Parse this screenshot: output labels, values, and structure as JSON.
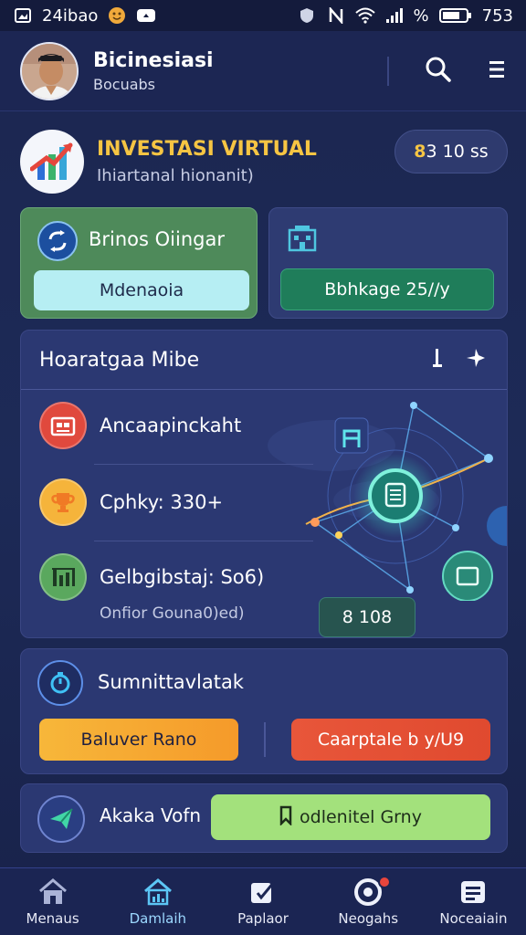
{
  "status_bar": {
    "app_label": "24ibao",
    "battery_text": "753",
    "percent_sign": "%",
    "icons": [
      "gallery-icon",
      "smiley-icon",
      "cloud-icon",
      "shield-icon",
      "nfc-icon",
      "wifi-icon",
      "signal-icon",
      "battery-icon"
    ]
  },
  "header": {
    "title": "Bicinesiasi",
    "subtitle": "Bocuabs",
    "icons": [
      "search-icon",
      "menu-icon"
    ]
  },
  "hero": {
    "title": "INVESTASI VIRTUAL",
    "subtitle": "Ihiartanаl hionanit)",
    "pill_number": "8",
    "pill_text": "3 10 ss"
  },
  "card_green": {
    "title": "Brinos Oiingar",
    "button": "Mdenaoia"
  },
  "card_blue": {
    "button": "Bbhkage 25//y"
  },
  "network": {
    "title": "Hoaratgaa Mibe",
    "rows": [
      {
        "label": "Ancaapinckaht",
        "icon": "store-icon",
        "color": "#e0493d"
      },
      {
        "label": "Cphky: 330+",
        "icon": "trophy-icon",
        "color": "#f5b43b"
      },
      {
        "label": "Gelbgibstaj: So6)",
        "icon": "chart-icon",
        "color": "#5aa85e"
      }
    ],
    "footer": "Onfior Gouna0)ed)",
    "counter": "8  108"
  },
  "action": {
    "title": "Sumnittavlatak",
    "button_left": "Baluver Rano",
    "button_right": "Caarptale b y/U9"
  },
  "send": {
    "title": "Akaka Vofn",
    "button": "odlenitel Grny"
  },
  "nav": [
    {
      "label": "Menaus",
      "icon": "home-icon",
      "active": false
    },
    {
      "label": "Damlaih",
      "icon": "house-chart-icon",
      "active": true
    },
    {
      "label": "Paplaor",
      "icon": "edit-icon",
      "active": false
    },
    {
      "label": "Neogahs",
      "icon": "notification-icon",
      "active": false
    },
    {
      "label": "Noceaiain",
      "icon": "list-icon",
      "active": false
    }
  ],
  "colors": {
    "background": "#1d2a57",
    "accent_gold": "#f6c543",
    "green_card": "#4e8a5a",
    "orange_button": "#f7b73a",
    "red_button": "#e8563a",
    "lime_button": "#a3e17c"
  }
}
